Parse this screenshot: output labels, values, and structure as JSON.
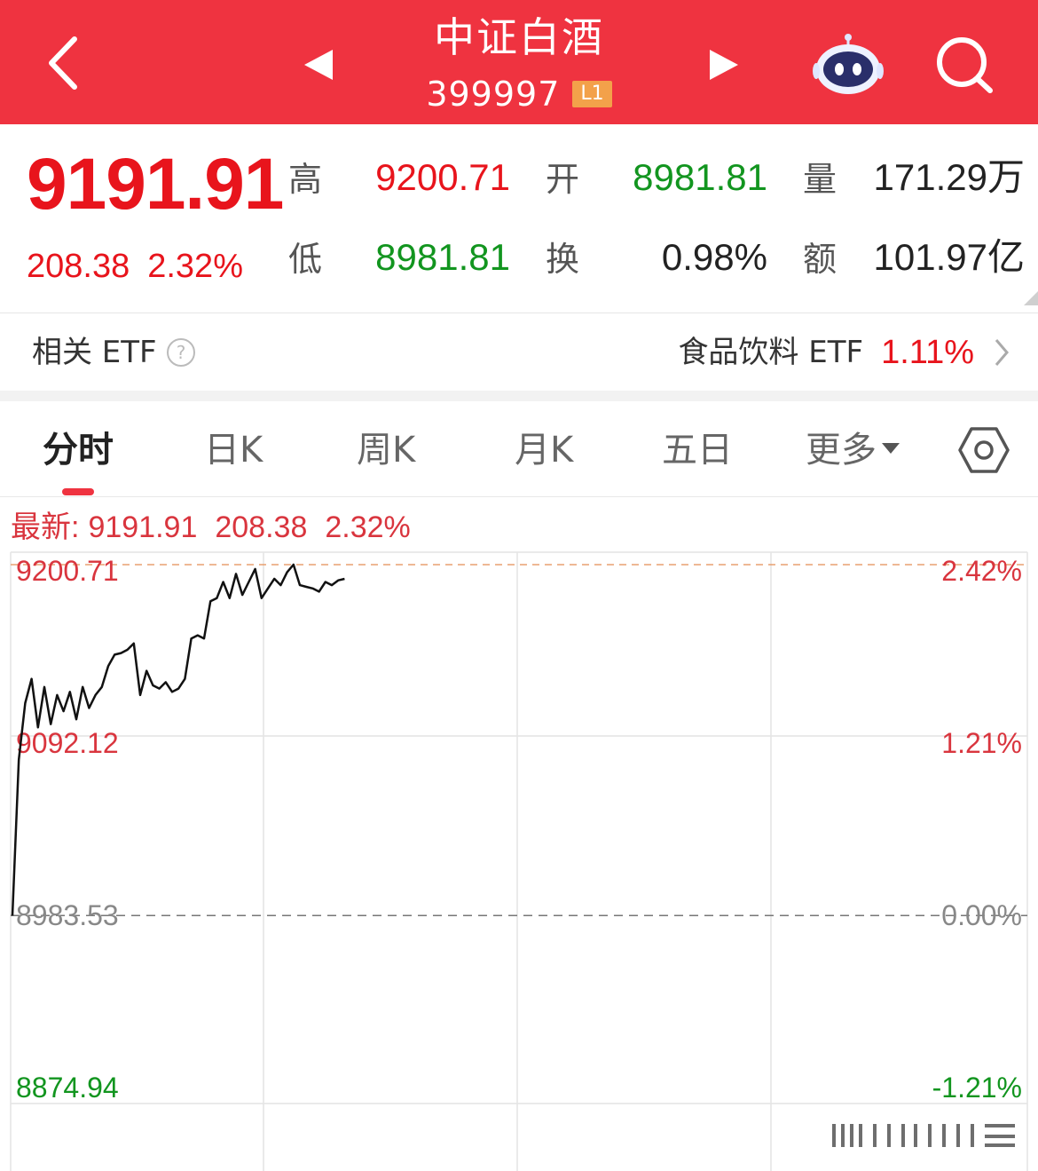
{
  "header": {
    "title": "中证白酒",
    "code": "399997",
    "level_badge": "L1",
    "icons": [
      "back-arrow-icon",
      "prev-triangle-icon",
      "next-triangle-icon",
      "robot-assistant-icon",
      "search-icon"
    ]
  },
  "quote": {
    "price": "9191.91",
    "change": "208.38",
    "change_pct": "2.32%",
    "stats": {
      "high_label": "高",
      "high": "9200.71",
      "open_label": "开",
      "open": "8981.81",
      "volume_label": "量",
      "volume": "171.29万",
      "low_label": "低",
      "low": "8981.81",
      "turnover_label": "换",
      "turnover": "0.98%",
      "amount_label": "额",
      "amount": "101.97亿"
    }
  },
  "etf": {
    "label": "相关 ETF",
    "name": "食品饮料 ETF",
    "pct": "1.11%"
  },
  "tabs": {
    "items": [
      "分时",
      "日K",
      "周K",
      "月K",
      "五日",
      "更多"
    ],
    "active": "分时"
  },
  "latest": {
    "label": "最新:",
    "price": "9191.91",
    "change": "208.38",
    "pct": "2.32%"
  },
  "colors": {
    "header_red": "#ef3340",
    "up_red": "#e8141c",
    "down_green": "#12951f",
    "badge_orange": "#f3a14a"
  },
  "chart_data": {
    "type": "line",
    "series": [
      {
        "values": [
          8983.53,
          9080,
          9115,
          9130,
          9100,
          9125,
          9102,
          9120,
          9110,
          9122,
          9105,
          9125,
          9112,
          9120,
          9125,
          9138,
          9145,
          9146,
          9148,
          9152,
          9120,
          9135,
          9126,
          9124,
          9128,
          9122,
          9124,
          9130,
          9155,
          9157,
          9155,
          9178,
          9180,
          9190,
          9180,
          9195,
          9182,
          9190,
          9198,
          9180,
          9186,
          9192,
          9188,
          9196,
          9200.71,
          9188,
          9187,
          9186,
          9184,
          9190,
          9188,
          9191,
          9191.91
        ]
      }
    ],
    "y_left_ticks": [
      "9200.71",
      "9092.12",
      "8983.53",
      "8874.94"
    ],
    "y_right_ticks": [
      "2.42%",
      "1.21%",
      "0.00%",
      "-1.21%"
    ],
    "ylim": [
      8874.94,
      9200.71
    ],
    "prev_close": 8983.53,
    "grid": true
  }
}
